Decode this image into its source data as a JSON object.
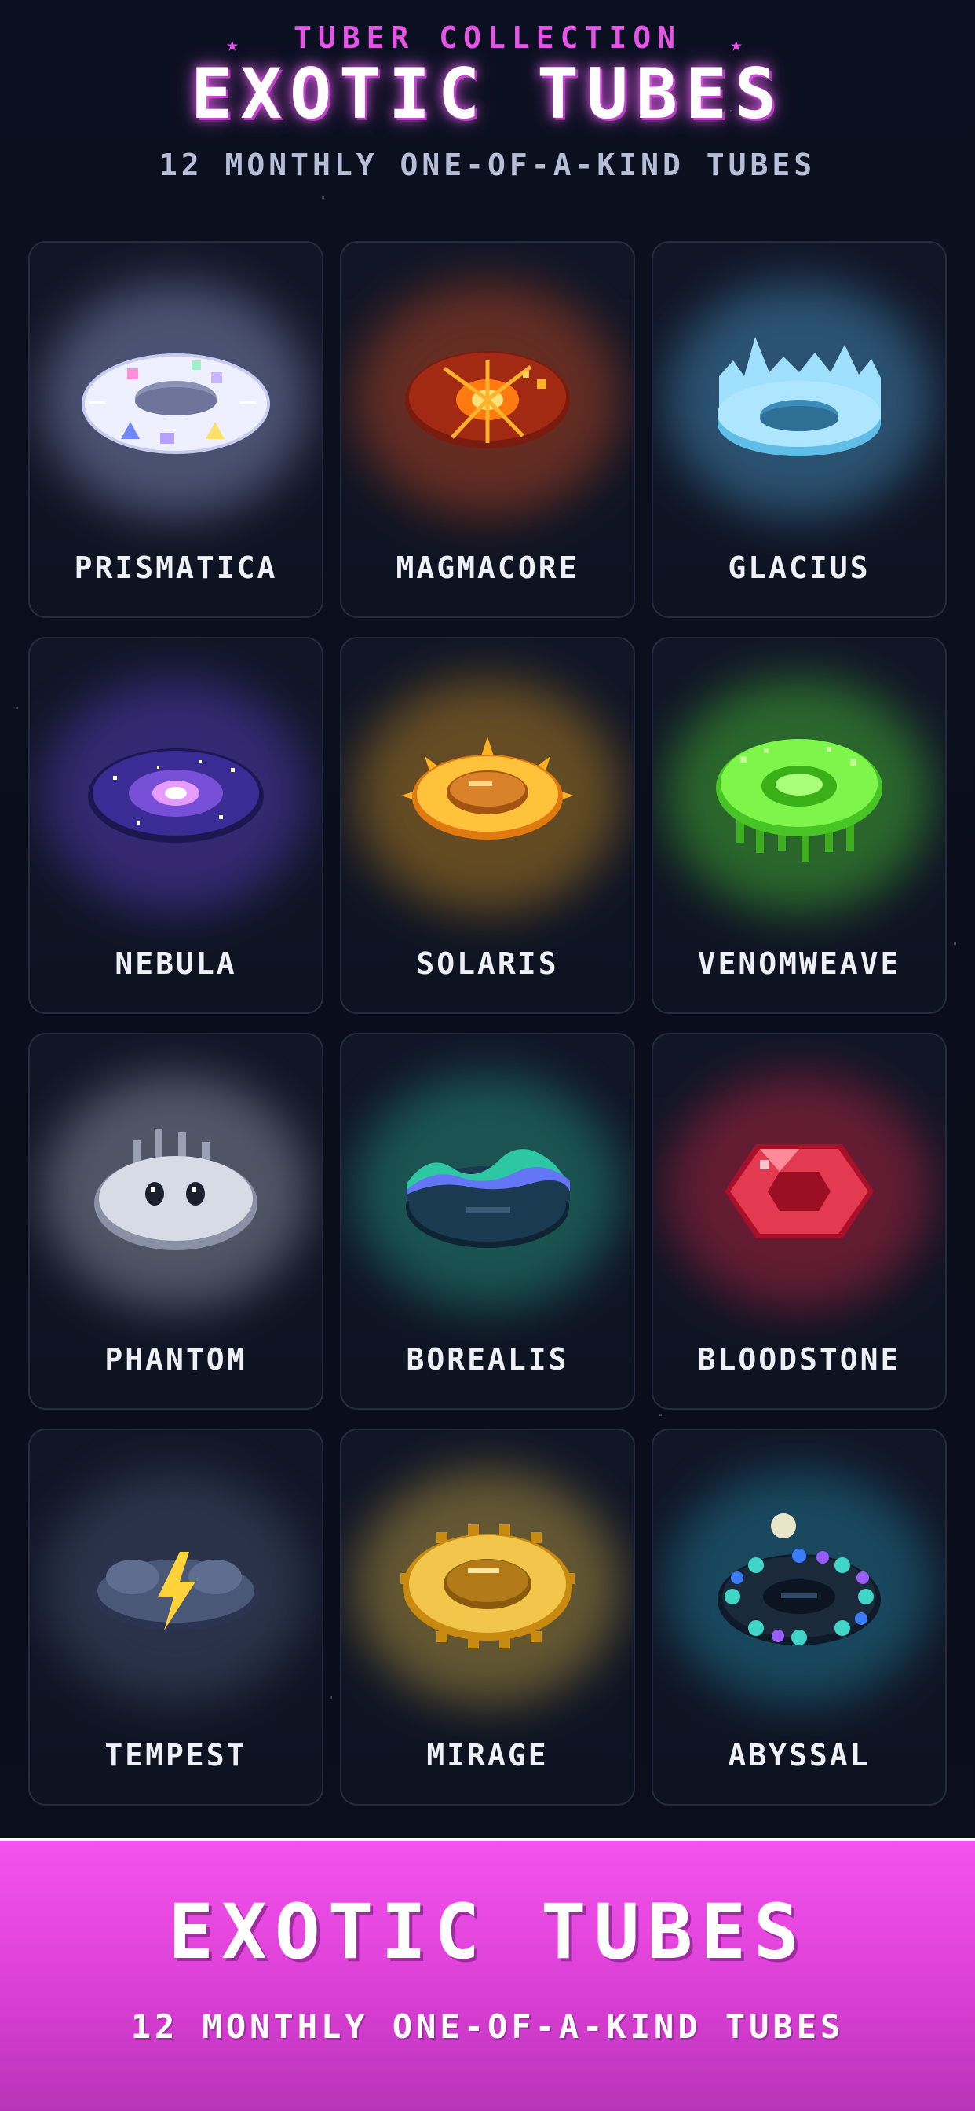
{
  "header": {
    "eyebrow": "TUBER COLLECTION",
    "title": "EXOTIC TUBES",
    "subtitle": "12 MONTHLY ONE-OF-A-KIND TUBES"
  },
  "colors": {
    "accent": "#e455e6",
    "background": "#0b1020",
    "card_border": "#262c3f",
    "footer_top": "#f552ef",
    "footer_bottom": "#b734b8"
  },
  "tubes": [
    {
      "name": "PRISMATICA",
      "icon": "prismatica-tube-icon",
      "glow": "#b9c2ff"
    },
    {
      "name": "MAGMACORE",
      "icon": "magmacore-tube-icon",
      "glow": "#ff5a1f"
    },
    {
      "name": "GLACIUS",
      "icon": "glacius-tube-icon",
      "glow": "#5fc4ff"
    },
    {
      "name": "NEBULA",
      "icon": "nebula-tube-icon",
      "glow": "#7a4dff"
    },
    {
      "name": "SOLARIS",
      "icon": "solaris-tube-icon",
      "glow": "#ffb020"
    },
    {
      "name": "VENOMWEAVE",
      "icon": "venomweave-tube-icon",
      "glow": "#5dff3a"
    },
    {
      "name": "PHANTOM",
      "icon": "phantom-tube-icon",
      "glow": "#c7cde0"
    },
    {
      "name": "BOREALIS",
      "icon": "borealis-tube-icon",
      "glow": "#2ec7a4"
    },
    {
      "name": "BLOODSTONE",
      "icon": "bloodstone-tube-icon",
      "glow": "#ff2a4a"
    },
    {
      "name": "TEMPEST",
      "icon": "tempest-tube-icon",
      "glow": "#5a6a8c"
    },
    {
      "name": "MIRAGE",
      "icon": "mirage-tube-icon",
      "glow": "#ffd24a"
    },
    {
      "name": "ABYSSAL",
      "icon": "abyssal-tube-icon",
      "glow": "#2aa7c9"
    }
  ],
  "footer": {
    "title": "EXOTIC TUBES",
    "subtitle": "12 MONTHLY ONE-OF-A-KIND TUBES"
  }
}
